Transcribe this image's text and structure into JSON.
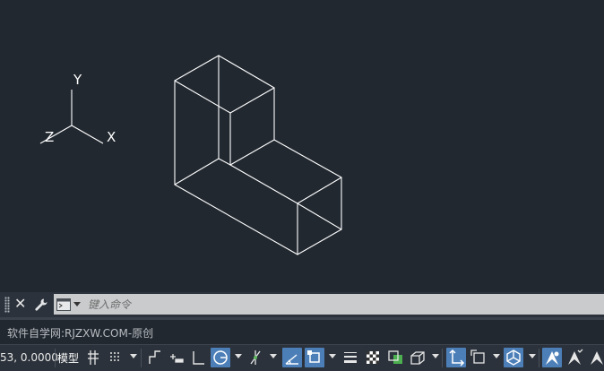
{
  "viewport": {
    "ucs_labels": {
      "x": "X",
      "y": "Y",
      "z": "Z"
    },
    "colors": {
      "background": "#212830",
      "lines": "#ffffff"
    }
  },
  "command_line": {
    "placeholder": "键入命令",
    "close_icon": "close-icon",
    "settings_icon": "wrench-icon",
    "recent_commands_icon": "command-prompt-icon"
  },
  "watermark": {
    "text": "软件自学网:RJZXW.COM-原创"
  },
  "status_bar": {
    "coordinates": "53, 0.0000",
    "model_label": "模型",
    "accent_color": "#4c7fb8",
    "buttons": [
      {
        "icon": "grid-icon",
        "active": false
      },
      {
        "icon": "snap-mode-icon",
        "active": false
      },
      {
        "icon": "infer-constraints-icon",
        "active": false
      },
      {
        "icon": "dynamic-input-icon",
        "active": false
      },
      {
        "icon": "ortho-mode-icon",
        "active": false
      },
      {
        "icon": "polar-tracking-icon",
        "active": true
      },
      {
        "icon": "isometric-drafting-icon",
        "active": false
      },
      {
        "icon": "object-snap-tracking-icon",
        "active": true
      },
      {
        "icon": "object-snap-icon",
        "active": true
      },
      {
        "icon": "lineweight-icon",
        "active": false
      },
      {
        "icon": "transparency-icon",
        "active": false
      },
      {
        "icon": "selection-cycling-icon",
        "active": false
      },
      {
        "icon": "3d-object-snap-icon",
        "active": false
      },
      {
        "icon": "dynamic-ucs-icon",
        "active": true
      },
      {
        "icon": "selection-filtering-icon",
        "active": false
      },
      {
        "icon": "gizmo-icon",
        "active": true
      },
      {
        "icon": "annotation-visibility-icon",
        "active": true
      },
      {
        "icon": "auto-scale-icon",
        "active": false
      },
      {
        "icon": "annotation-scale-icon",
        "active": false
      }
    ]
  }
}
